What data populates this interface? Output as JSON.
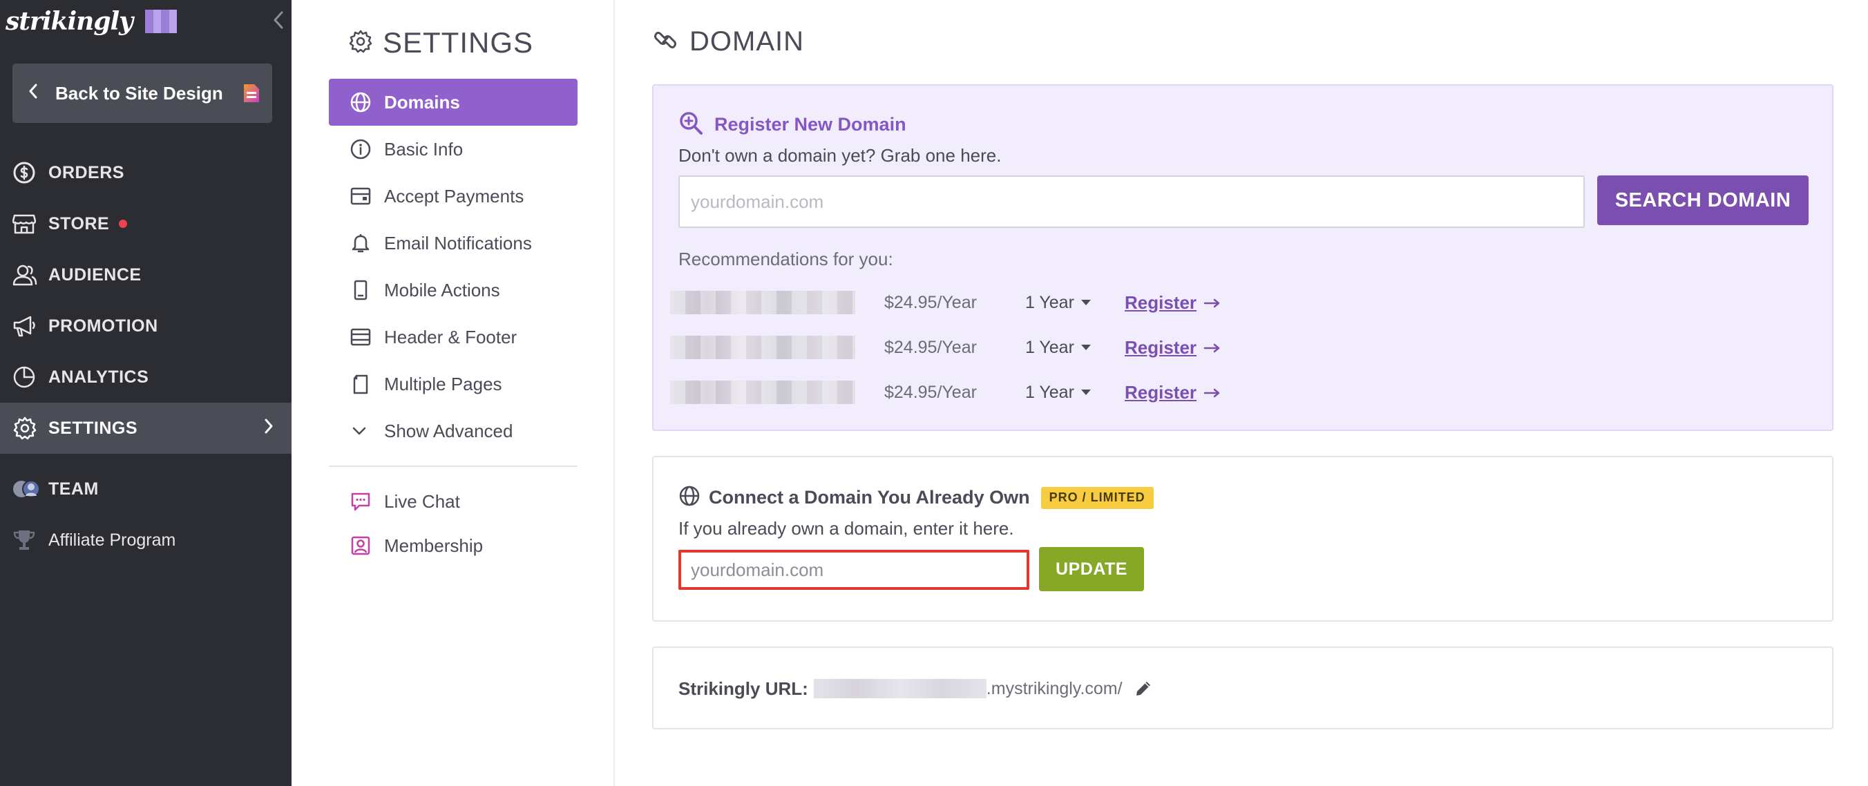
{
  "sidebar": {
    "logo_text": "strikingly",
    "back_label": "Back to Site Design",
    "items": [
      {
        "label": "ORDERS",
        "icon": "dollar-circle-icon"
      },
      {
        "label": "STORE",
        "icon": "store-icon",
        "badge": "red-dot"
      },
      {
        "label": "AUDIENCE",
        "icon": "audience-icon"
      },
      {
        "label": "PROMOTION",
        "icon": "megaphone-icon"
      },
      {
        "label": "ANALYTICS",
        "icon": "pie-chart-icon"
      },
      {
        "label": "SETTINGS",
        "icon": "gear-icon",
        "active": true
      },
      {
        "label": "TEAM",
        "icon": "team-avatars-icon"
      },
      {
        "label": "Affiliate Program",
        "icon": "trophy-icon"
      }
    ]
  },
  "settings": {
    "title": "SETTINGS",
    "menu": [
      {
        "label": "Domains",
        "icon": "globe-icon",
        "active": true
      },
      {
        "label": "Basic Info",
        "icon": "info-icon"
      },
      {
        "label": "Accept Payments",
        "icon": "payment-card-icon"
      },
      {
        "label": "Email Notifications",
        "icon": "bell-icon"
      },
      {
        "label": "Mobile Actions",
        "icon": "mobile-icon"
      },
      {
        "label": "Header & Footer",
        "icon": "header-footer-icon"
      },
      {
        "label": "Multiple Pages",
        "icon": "pages-icon"
      },
      {
        "label": "Show Advanced",
        "icon": "chevron-down-icon"
      }
    ],
    "extras": [
      {
        "label": "Live Chat",
        "icon": "chat-icon"
      },
      {
        "label": "Membership",
        "icon": "membership-icon"
      }
    ]
  },
  "domain": {
    "title": "DOMAIN",
    "register": {
      "title": "Register New Domain",
      "subtitle": "Don't own a domain yet? Grab one here.",
      "placeholder": "yourdomain.com",
      "search_button": "SEARCH DOMAIN",
      "recommendations_label": "Recommendations for you:",
      "recommendations": [
        {
          "price": "$24.95/Year",
          "period": "1 Year",
          "action": "Register"
        },
        {
          "price": "$24.95/Year",
          "period": "1 Year",
          "action": "Register"
        },
        {
          "price": "$24.95/Year",
          "period": "1 Year",
          "action": "Register"
        }
      ]
    },
    "connect": {
      "title": "Connect a Domain You Already Own",
      "badge": "PRO / LIMITED",
      "subtitle": "If you already own a domain, enter it here.",
      "placeholder": "yourdomain.com",
      "update_button": "UPDATE"
    },
    "url": {
      "label": "Strikingly URL:",
      "suffix": ".mystrikingly.com/"
    }
  },
  "colors": {
    "sidebar_bg": "#2c2d33",
    "accent_purple": "#9060cc",
    "search_button": "#7a4fb0",
    "update_button": "#86a826",
    "badge_yellow": "#f7cc3e",
    "highlight_red": "#e0372f"
  }
}
